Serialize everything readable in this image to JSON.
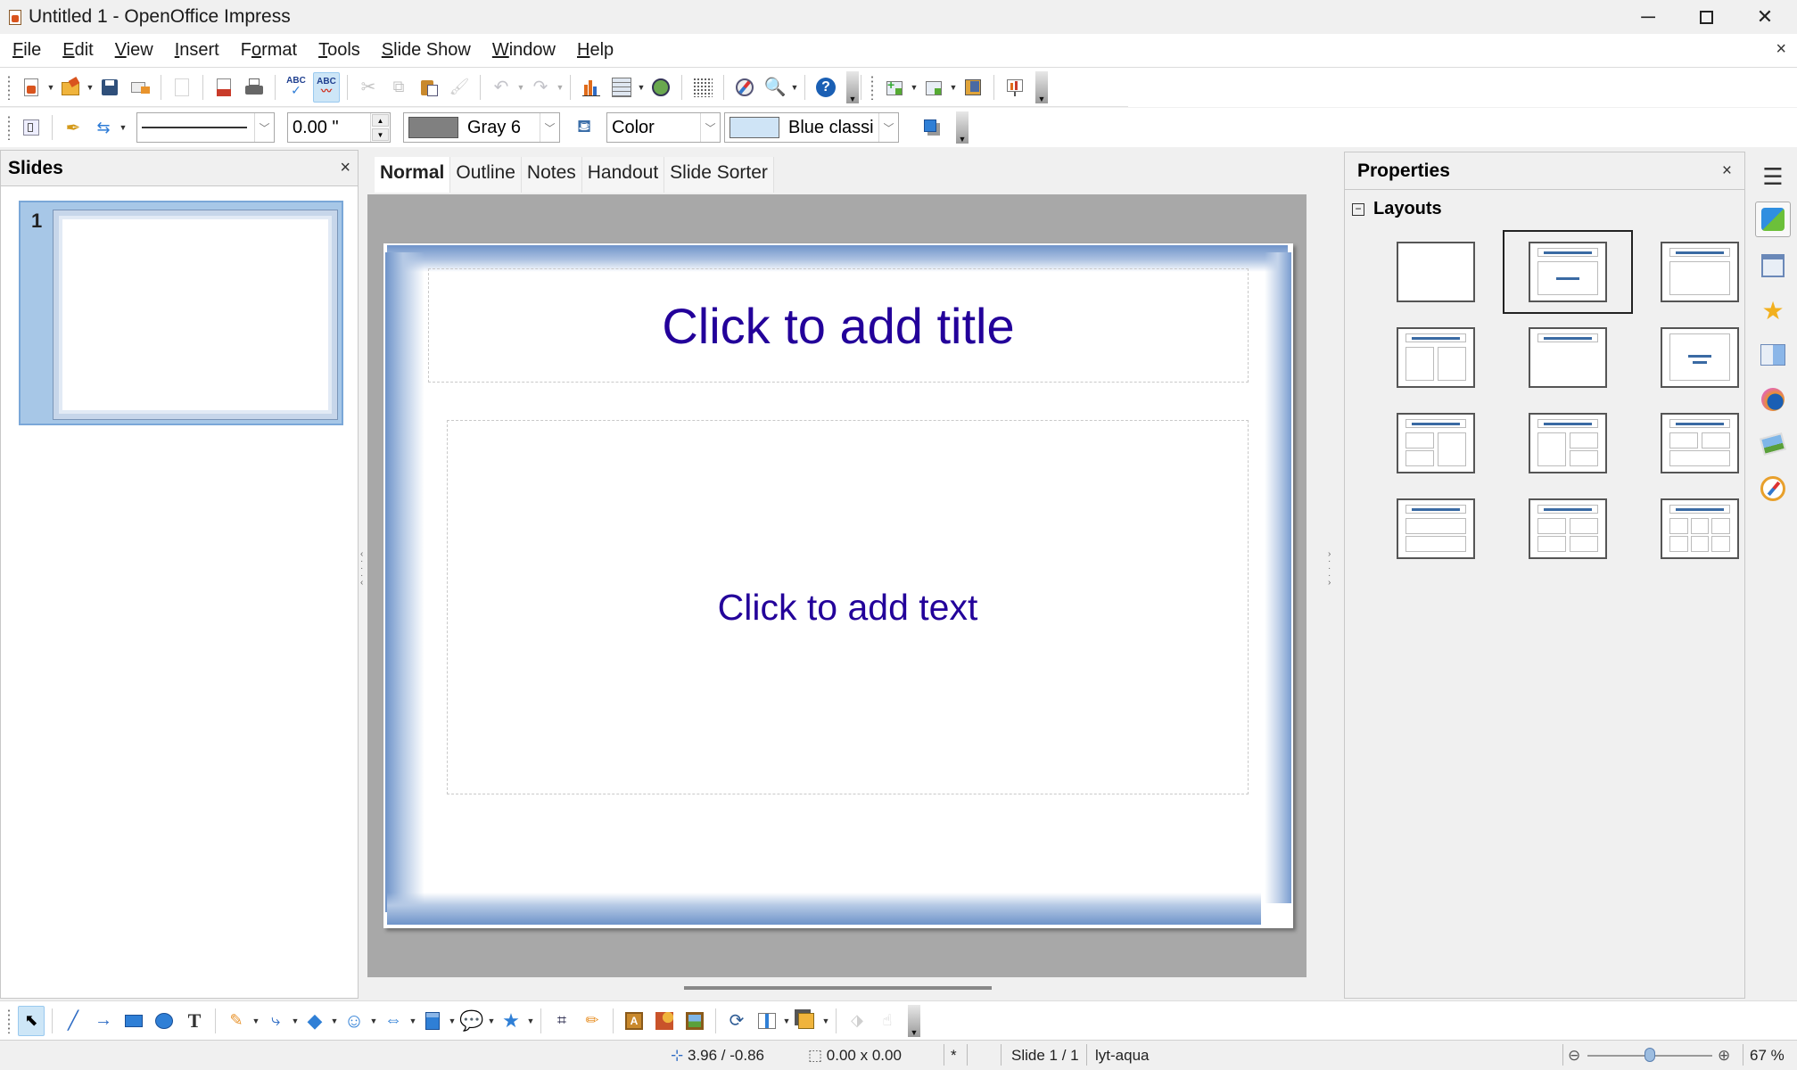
{
  "window": {
    "title": "Untitled 1 - OpenOffice Impress",
    "minimize_icon": "minimize-icon",
    "maximize_icon": "maximize-icon",
    "close_icon": "close-icon"
  },
  "menubar": {
    "items": [
      {
        "label": "File",
        "mnemonic": "F"
      },
      {
        "label": "Edit",
        "mnemonic": "E"
      },
      {
        "label": "View",
        "mnemonic": "V"
      },
      {
        "label": "Insert",
        "mnemonic": "I"
      },
      {
        "label": "Format",
        "mnemonic": "o"
      },
      {
        "label": "Tools",
        "mnemonic": "T"
      },
      {
        "label": "Slide Show",
        "mnemonic": "S"
      },
      {
        "label": "Window",
        "mnemonic": "W"
      },
      {
        "label": "Help",
        "mnemonic": "H"
      }
    ],
    "close_document": "×"
  },
  "standard_toolbar": {
    "buttons": [
      "new",
      "open",
      "save",
      "email-document",
      "edit-file",
      "export-pdf",
      "print",
      "spellcheck",
      "auto-spellcheck",
      "cut",
      "copy",
      "paste",
      "clone-formatting",
      "undo",
      "redo",
      "chart",
      "table",
      "insert-hyperlink",
      "grid",
      "navigator",
      "zoom",
      "help"
    ],
    "presentation_buttons": [
      "new-slide",
      "slide-layout",
      "slide-design",
      "slide-show"
    ]
  },
  "line_fill_toolbar": {
    "line_style": "",
    "line_width": "0.00 \"",
    "line_color_name": "Gray 6",
    "line_color": "#808080",
    "area_style": "Color",
    "fill_color_name": "Blue classi",
    "fill_color": "#cfe4f6"
  },
  "slides_pane": {
    "title": "Slides",
    "close": "×",
    "slides": [
      {
        "number": "1"
      }
    ]
  },
  "view_tabs": [
    "Normal",
    "Outline",
    "Notes",
    "Handout",
    "Slide Sorter"
  ],
  "active_tab": "Normal",
  "slide": {
    "title_placeholder": "Click to add title",
    "body_placeholder": "Click to add text",
    "text_color": "#23009a"
  },
  "properties": {
    "title": "Properties",
    "close": "×",
    "section": "Layouts",
    "collapse_symbol": "−",
    "layouts": [
      "Blank Slide",
      "Title Slide",
      "Title, Content",
      "Title and 2 Content",
      "Title Only",
      "Centered Text",
      "Title, 2 Content and Content",
      "Title, Content and 2 Content",
      "Title, 2 Content over Content",
      "Title, Content over Content",
      "Title, 4 Content",
      "Title, 6 Content"
    ],
    "selected_layout": "Title Slide"
  },
  "sidebar_tabs": [
    "sidebar-menu",
    "properties",
    "master-pages",
    "custom-animation",
    "slide-transition",
    "styles-formatting",
    "gallery",
    "navigator"
  ],
  "drawing_toolbar": {
    "buttons": [
      "select",
      "line",
      "line-ends-arrow",
      "rectangle",
      "ellipse",
      "text",
      "curve",
      "connector",
      "basic-shapes",
      "symbol-shapes",
      "block-arrows",
      "flowcharts",
      "callouts",
      "stars",
      "points",
      "glue-points",
      "fontwork",
      "from-file",
      "gallery",
      "rotate",
      "align",
      "arrange",
      "extrusion",
      "interaction"
    ]
  },
  "statusbar": {
    "position": "3.96 / -0.86",
    "size": "0.00 x 0.00",
    "modified": "*",
    "slide": "Slide 1 / 1",
    "master": "lyt-aqua",
    "zoom_percent": "67 %",
    "zoom_minus": "⊖",
    "zoom_plus": "⊕",
    "zoom_level": 0.5
  }
}
